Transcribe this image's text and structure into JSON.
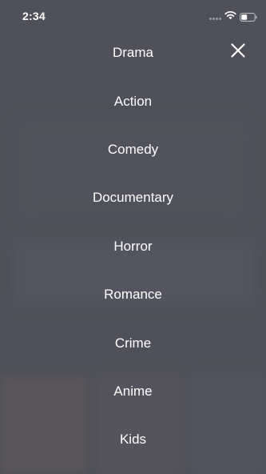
{
  "status_bar": {
    "time": "2:34"
  },
  "icons": {
    "close": "close-icon",
    "wifi": "wifi-icon",
    "battery": "battery-icon",
    "signal": "signal-icon"
  },
  "menu": {
    "items": [
      {
        "label": "Drama"
      },
      {
        "label": "Action"
      },
      {
        "label": "Comedy"
      },
      {
        "label": "Documentary"
      },
      {
        "label": "Horror"
      },
      {
        "label": "Romance"
      },
      {
        "label": "Crime"
      },
      {
        "label": "Anime"
      },
      {
        "label": "Kids"
      }
    ]
  },
  "colors": {
    "overlay": "#4f5059",
    "text": "#ffffff"
  }
}
